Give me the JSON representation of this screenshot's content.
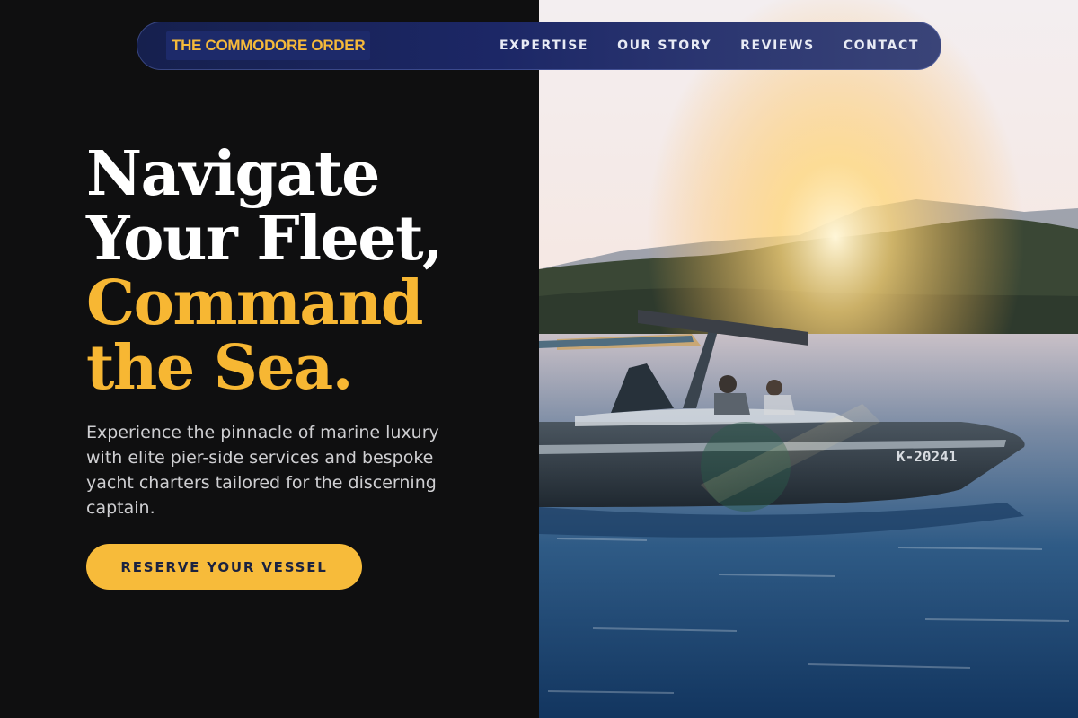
{
  "nav": {
    "brand": "THE COMMODORE ORDER",
    "links": [
      "EXPERTISE",
      "OUR STORY",
      "REVIEWS",
      "CONTACT"
    ]
  },
  "hero": {
    "title_lines": [
      "Navigate",
      "Your Fleet,",
      "Command",
      "the Sea."
    ],
    "subtitle": "Experience the pinnacle of marine luxury with elite pier-side services and bespoke yacht charters tailored for the discerning captain.",
    "cta_label": "RESERVE YOUR VESSEL"
  },
  "photo": {
    "hull_number": "K-20241"
  },
  "colors": {
    "accent_gold": "#f7b733",
    "navy": "#1c2766",
    "background": "#0f0f10"
  }
}
